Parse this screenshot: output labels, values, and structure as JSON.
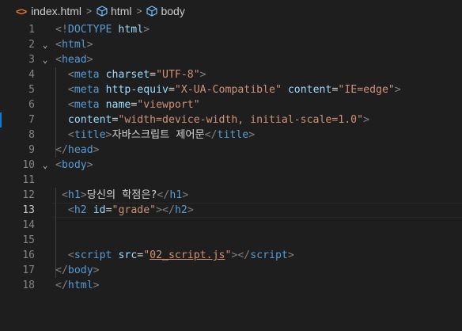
{
  "breadcrumb": {
    "file": "index.html",
    "items": [
      "html",
      "body"
    ]
  },
  "editor": {
    "current_line": 13,
    "lines": [
      {
        "n": "1",
        "fold": "",
        "indent": 0,
        "tokens": [
          {
            "c": "t-brk",
            "t": "<!"
          },
          {
            "c": "t-tag",
            "t": "DOCTYPE"
          },
          {
            "c": "t-text",
            "t": " "
          },
          {
            "c": "t-attr",
            "t": "html"
          },
          {
            "c": "t-brk",
            "t": ">"
          }
        ]
      },
      {
        "n": "2",
        "fold": "⌄",
        "indent": 0,
        "tokens": [
          {
            "c": "t-brk",
            "t": "<"
          },
          {
            "c": "t-tag",
            "t": "html"
          },
          {
            "c": "t-brk",
            "t": ">"
          }
        ]
      },
      {
        "n": "3",
        "fold": "⌄",
        "indent": 0,
        "tokens": [
          {
            "c": "t-brk",
            "t": "<"
          },
          {
            "c": "t-tag",
            "t": "head"
          },
          {
            "c": "t-brk",
            "t": ">"
          }
        ]
      },
      {
        "n": "4",
        "fold": "",
        "indent": 2,
        "tokens": [
          {
            "c": "t-brk",
            "t": "<"
          },
          {
            "c": "t-tag",
            "t": "meta"
          },
          {
            "c": "t-text",
            "t": " "
          },
          {
            "c": "t-attr",
            "t": "charset"
          },
          {
            "c": "t-text",
            "t": "="
          },
          {
            "c": "t-str",
            "t": "\"UTF-8\""
          },
          {
            "c": "t-brk",
            "t": ">"
          }
        ]
      },
      {
        "n": "5",
        "fold": "",
        "indent": 2,
        "tokens": [
          {
            "c": "t-brk",
            "t": "<"
          },
          {
            "c": "t-tag",
            "t": "meta"
          },
          {
            "c": "t-text",
            "t": " "
          },
          {
            "c": "t-attr",
            "t": "http-equiv"
          },
          {
            "c": "t-text",
            "t": "="
          },
          {
            "c": "t-str",
            "t": "\"X-UA-Compatible\""
          },
          {
            "c": "t-text",
            "t": " "
          },
          {
            "c": "t-attr",
            "t": "content"
          },
          {
            "c": "t-text",
            "t": "="
          },
          {
            "c": "t-str",
            "t": "\"IE=edge\""
          },
          {
            "c": "t-brk",
            "t": ">"
          }
        ]
      },
      {
        "n": "6",
        "fold": "",
        "indent": 2,
        "tokens": [
          {
            "c": "t-brk",
            "t": "<"
          },
          {
            "c": "t-tag",
            "t": "meta"
          },
          {
            "c": "t-text",
            "t": " "
          },
          {
            "c": "t-attr",
            "t": "name"
          },
          {
            "c": "t-text",
            "t": "="
          },
          {
            "c": "t-str",
            "t": "\"viewport\""
          }
        ]
      },
      {
        "n": "7",
        "fold": "",
        "indent": 2,
        "tokens": [
          {
            "c": "t-attr",
            "t": "content"
          },
          {
            "c": "t-text",
            "t": "="
          },
          {
            "c": "t-str",
            "t": "\"width=device-width, initial-scale=1.0\""
          },
          {
            "c": "t-brk",
            "t": ">"
          }
        ]
      },
      {
        "n": "8",
        "fold": "",
        "indent": 2,
        "tokens": [
          {
            "c": "t-brk",
            "t": "<"
          },
          {
            "c": "t-tag",
            "t": "title"
          },
          {
            "c": "t-brk",
            "t": ">"
          },
          {
            "c": "t-text",
            "t": "자바스크립트 제어문"
          },
          {
            "c": "t-brk",
            "t": "</"
          },
          {
            "c": "t-tag",
            "t": "title"
          },
          {
            "c": "t-brk",
            "t": ">"
          }
        ]
      },
      {
        "n": "9",
        "fold": "",
        "indent": 0,
        "tokens": [
          {
            "c": "t-brk",
            "t": "</"
          },
          {
            "c": "t-tag",
            "t": "head"
          },
          {
            "c": "t-brk",
            "t": ">"
          }
        ]
      },
      {
        "n": "10",
        "fold": "⌄",
        "indent": 0,
        "tokens": [
          {
            "c": "t-brk",
            "t": "<"
          },
          {
            "c": "t-tag",
            "t": "body"
          },
          {
            "c": "t-brk",
            "t": ">"
          }
        ]
      },
      {
        "n": "11",
        "fold": "",
        "indent": 0,
        "tokens": []
      },
      {
        "n": "12",
        "fold": "",
        "indent": 1,
        "tokens": [
          {
            "c": "t-brk",
            "t": "<"
          },
          {
            "c": "t-tag",
            "t": "h1"
          },
          {
            "c": "t-brk",
            "t": ">"
          },
          {
            "c": "t-text",
            "t": "당신의 학점은?"
          },
          {
            "c": "t-brk",
            "t": "</"
          },
          {
            "c": "t-tag",
            "t": "h1"
          },
          {
            "c": "t-brk",
            "t": ">"
          }
        ]
      },
      {
        "n": "13",
        "fold": "",
        "indent": 2,
        "tokens": [
          {
            "c": "t-brk",
            "t": "<"
          },
          {
            "c": "t-tag",
            "t": "h2"
          },
          {
            "c": "t-text",
            "t": " "
          },
          {
            "c": "t-attr",
            "t": "id"
          },
          {
            "c": "t-text",
            "t": "="
          },
          {
            "c": "t-str",
            "t": "\"grade\""
          },
          {
            "c": "t-brk",
            "t": "></"
          },
          {
            "c": "t-tag",
            "t": "h2"
          },
          {
            "c": "t-brk",
            "t": ">"
          }
        ]
      },
      {
        "n": "14",
        "fold": "",
        "indent": 0,
        "tokens": []
      },
      {
        "n": "15",
        "fold": "",
        "indent": 0,
        "tokens": []
      },
      {
        "n": "16",
        "fold": "",
        "indent": 2,
        "tokens": [
          {
            "c": "t-brk",
            "t": "<"
          },
          {
            "c": "t-tag",
            "t": "script"
          },
          {
            "c": "t-text",
            "t": " "
          },
          {
            "c": "t-attr",
            "t": "src"
          },
          {
            "c": "t-text",
            "t": "="
          },
          {
            "c": "t-str",
            "t": "\""
          },
          {
            "c": "t-str t-link",
            "t": "02_script.js"
          },
          {
            "c": "t-str",
            "t": "\""
          },
          {
            "c": "t-brk",
            "t": "></"
          },
          {
            "c": "t-tag",
            "t": "script"
          },
          {
            "c": "t-brk",
            "t": ">"
          }
        ]
      },
      {
        "n": "17",
        "fold": "",
        "indent": 0,
        "tokens": [
          {
            "c": "t-brk",
            "t": "</"
          },
          {
            "c": "t-tag",
            "t": "body"
          },
          {
            "c": "t-brk",
            "t": ">"
          }
        ]
      },
      {
        "n": "18",
        "fold": "",
        "indent": 0,
        "tokens": [
          {
            "c": "t-brk",
            "t": "</"
          },
          {
            "c": "t-tag",
            "t": "html"
          },
          {
            "c": "t-brk",
            "t": ">"
          }
        ]
      }
    ]
  }
}
